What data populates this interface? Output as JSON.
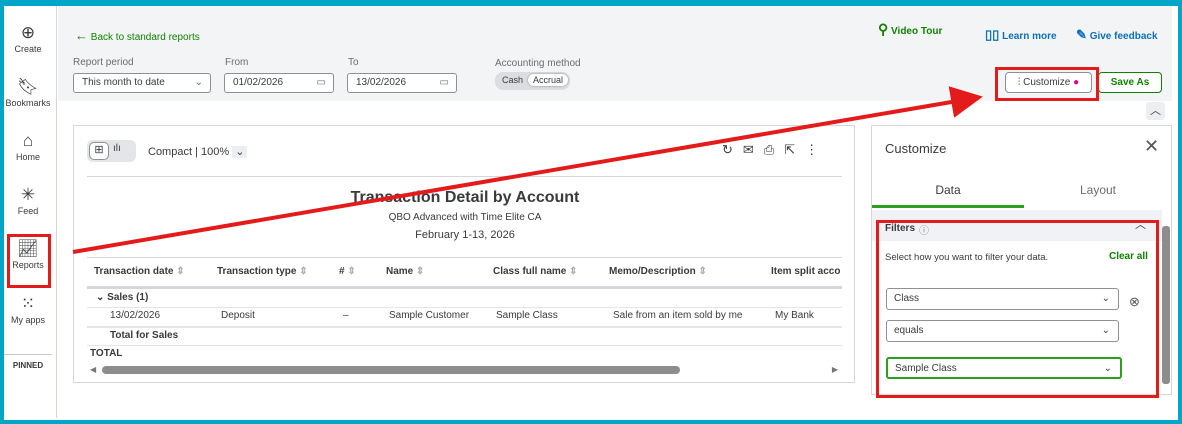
{
  "sidebar": {
    "items": [
      {
        "label": "Create",
        "icon": "plus-circle-icon"
      },
      {
        "label": "Bookmarks",
        "icon": "bookmark-icon"
      },
      {
        "label": "Home",
        "icon": "home-icon"
      },
      {
        "label": "Feed",
        "icon": "feed-icon"
      },
      {
        "label": "Reports",
        "icon": "reports-icon"
      },
      {
        "label": "My apps",
        "icon": "apps-icon"
      }
    ],
    "pinned": "PINNED"
  },
  "header": {
    "back": "Back to standard reports",
    "video_tour": "Video Tour",
    "learn_more": "Learn more",
    "give_feedback": "Give feedback",
    "report_period": {
      "label": "Report period",
      "value": "This month to date"
    },
    "from": {
      "label": "From",
      "value": "01/02/2026"
    },
    "to": {
      "label": "To",
      "value": "13/02/2026"
    },
    "accounting": {
      "label": "Accounting method",
      "options": [
        "Cash",
        "Accrual"
      ],
      "selected": "Accrual"
    },
    "customize": "Customize",
    "save_as": "Save As"
  },
  "report": {
    "view": "Compact | 100%",
    "title": "Transaction Detail by Account",
    "company": "QBO Advanced with Time Elite CA",
    "period": "February 1-13, 2026",
    "columns": [
      "Transaction date",
      "Transaction type",
      "#",
      "Name",
      "Class full name",
      "Memo/Description",
      "Item split acco"
    ],
    "group": "Sales (1)",
    "row": [
      "13/02/2026",
      "Deposit",
      "–",
      "Sample Customer",
      "Sample Class",
      "Sale from an item sold by me",
      "My Bank"
    ],
    "group_total": "Total for Sales",
    "total": "TOTAL"
  },
  "customize": {
    "title": "Customize",
    "tabs": [
      "Data",
      "Layout"
    ],
    "filters": {
      "title": "Filters",
      "hint": "Select how you want to filter your data.",
      "clear_all": "Clear all",
      "field": "Class",
      "operator": "equals",
      "value": "Sample Class"
    }
  },
  "colors": {
    "accent": "#108000",
    "annotation": "#e41b1b",
    "frame": "#00a6c8"
  }
}
